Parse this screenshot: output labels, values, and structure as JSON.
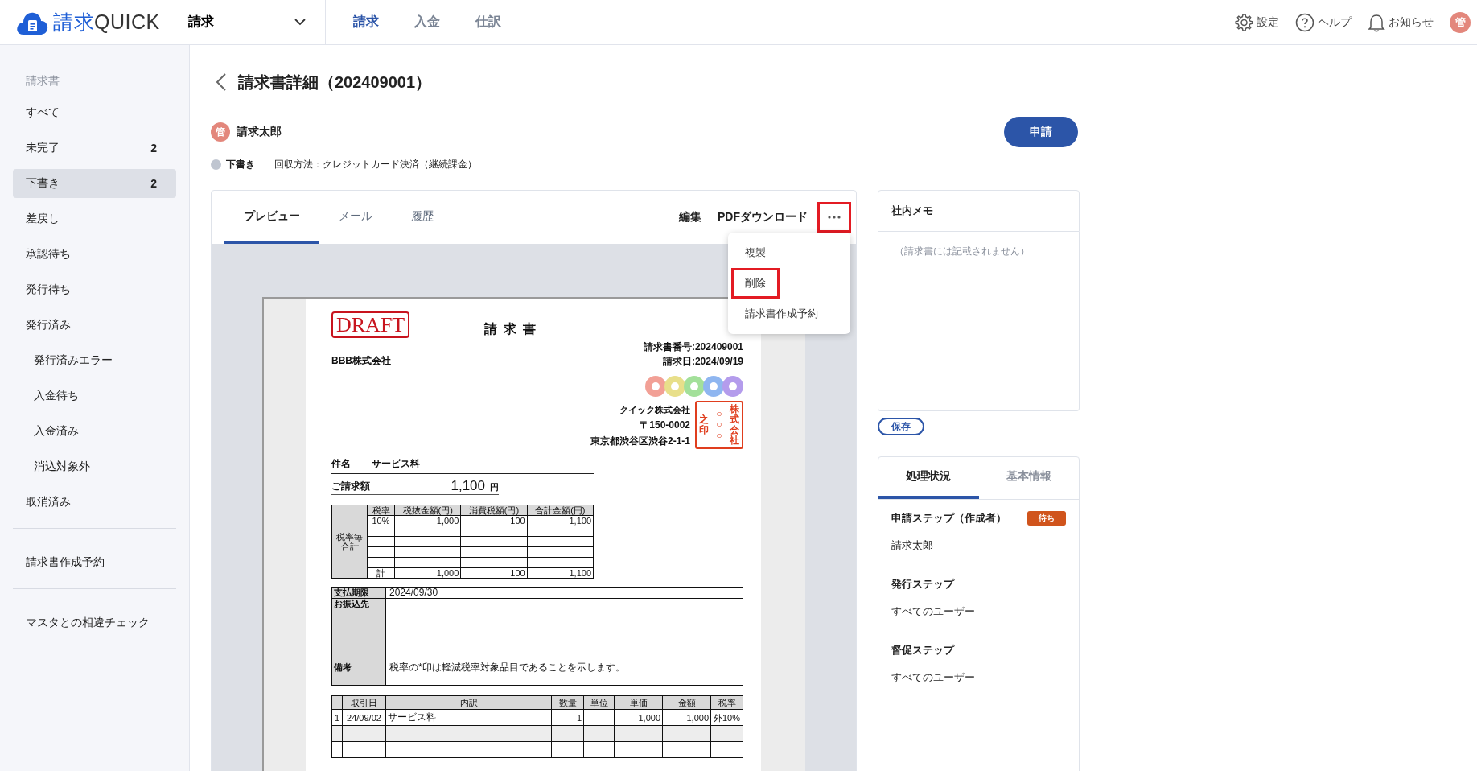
{
  "header": {
    "logo": {
      "part1": "請求",
      "part2": "QUICK"
    },
    "app_switcher": {
      "label": "請求"
    },
    "nav": [
      {
        "label": "請求",
        "selected": true
      },
      {
        "label": "入金",
        "selected": false
      },
      {
        "label": "仕訳",
        "selected": false
      }
    ],
    "utilities": [
      {
        "kind": "settings",
        "label": "設定"
      },
      {
        "kind": "help",
        "label": "ヘルプ"
      },
      {
        "kind": "notifications",
        "label": "お知らせ"
      }
    ],
    "avatar": "管"
  },
  "sidebar": {
    "section_title": "請求書",
    "groups": [
      {
        "items": [
          {
            "label": "すべて",
            "selected": false
          },
          {
            "label": "未完了",
            "count": "2",
            "selected": false
          },
          {
            "label": "下書き",
            "count": "2",
            "selected": true
          },
          {
            "label": "差戻し",
            "selected": false
          },
          {
            "label": "承認待ち",
            "selected": false
          },
          {
            "label": "発行待ち",
            "selected": false
          },
          {
            "label": "発行済み",
            "selected": false,
            "children": [
              {
                "label": "発行済みエラー",
                "selected": false
              },
              {
                "label": "入金待ち",
                "selected": false
              },
              {
                "label": "入金済み",
                "selected": false
              },
              {
                "label": "消込対象外",
                "selected": false
              }
            ]
          },
          {
            "label": "取消済み",
            "selected": false
          }
        ]
      },
      {
        "items": [
          {
            "label": "請求書作成予約",
            "selected": false
          }
        ]
      },
      {
        "items": [
          {
            "label": "マスタとの相違チェック",
            "selected": false
          }
        ]
      }
    ]
  },
  "page": {
    "title": "請求書詳細（202409001）",
    "user": {
      "avatar": "管",
      "name": "請求太郎"
    },
    "status": "下書き",
    "collection_method": "回収方法：クレジットカード決済（継続課金）",
    "apply_button": "申請"
  },
  "preview": {
    "tabs": [
      {
        "label": "プレビュー",
        "selected": true
      },
      {
        "label": "メール",
        "selected": false
      },
      {
        "label": "履歴",
        "selected": false
      }
    ],
    "actions": [
      {
        "kind": "text",
        "label": "編集"
      },
      {
        "kind": "text",
        "label": "PDFダウンロード"
      },
      {
        "kind": "more",
        "highlighted": true
      }
    ],
    "menu": [
      {
        "label": "複製",
        "highlighted": false
      },
      {
        "label": "削除",
        "highlighted": true
      },
      {
        "label": "請求書作成予約",
        "highlighted": false
      }
    ],
    "document": {
      "draft_stamp": "DRAFT",
      "title": "請求書",
      "number": "請求書番号:202409001",
      "date": "請求日:2024/09/19",
      "recipient": "BBB株式会社",
      "issuer": {
        "name": "クイック株式会社",
        "postal": "〒150-0002",
        "address": "東京都渋谷区渋谷2-1-1"
      },
      "seal_columns": [
        "之印",
        "○○○",
        "株式会社"
      ],
      "subject_label": "件名",
      "subject": "サービス料",
      "amount_label": "ご請求額",
      "amount": "1,100",
      "amount_unit": "円",
      "tax_table": {
        "side_label": "税率毎合計",
        "columns": [
          "税率",
          "税抜金額(円)",
          "消費税額(円)",
          "合計金額(円)"
        ],
        "rows": [
          {
            "kind": "data",
            "cells": [
              "10%",
              "1,000",
              "100",
              "1,100"
            ]
          },
          {
            "kind": "blank"
          },
          {
            "kind": "blank"
          },
          {
            "kind": "blank"
          },
          {
            "kind": "blank"
          },
          {
            "kind": "data",
            "cells": [
              "計",
              "1,000",
              "100",
              "1,100"
            ]
          }
        ]
      },
      "payment_table": [
        {
          "kind": "short",
          "label": "支払期限",
          "value": "2024/09/30"
        },
        {
          "kind": "tall",
          "label": "お振込先"
        },
        {
          "kind": "medium",
          "label": "備考",
          "value": "税率の*印は軽減税率対象品目であることを示します。"
        }
      ],
      "items_table": {
        "columns": [
          "取引日",
          "内訳",
          "数量",
          "単位",
          "単価",
          "金額",
          "税率"
        ],
        "rows": [
          {
            "kind": "item",
            "no": "1",
            "date": "24/09/02",
            "description": "サービス料",
            "quantity": "1",
            "unit_price": "1,000",
            "amount": "1,000",
            "tax": "外10%"
          },
          {
            "kind": "blank"
          },
          {
            "kind": "blank"
          }
        ]
      }
    }
  },
  "memo": {
    "title": "社内メモ",
    "placeholder": "（請求書には記載されません）",
    "save_button": "保存"
  },
  "workflow": {
    "tabs": [
      {
        "label": "処理状況",
        "selected": true
      },
      {
        "label": "基本情報",
        "selected": false
      }
    ],
    "steps": [
      {
        "title": "申請ステップ（作成者）",
        "badge": "待ち",
        "assignee": "請求太郎"
      },
      {
        "title": "発行ステップ",
        "assignee": "すべてのユーザー"
      },
      {
        "title": "督促ステップ",
        "assignee": "すべてのユーザー"
      }
    ]
  }
}
